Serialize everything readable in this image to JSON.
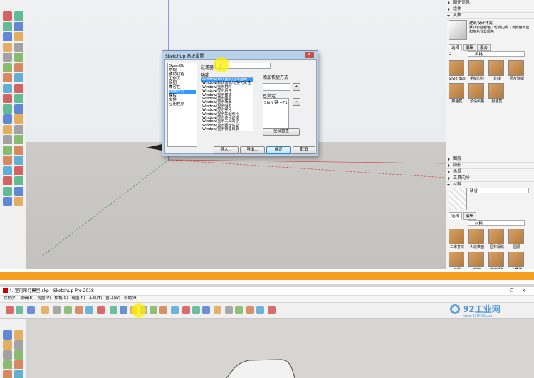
{
  "dialog": {
    "title": "SketchUp 系统设置",
    "close_glyph": "✕",
    "categories": [
      "OpenGL",
      "常规",
      "辅助功能",
      "工作区",
      "绘图",
      "兼容性",
      "快捷方式",
      "模板",
      "文件",
      "应用程序"
    ],
    "selected_category_index": 6,
    "filter_label": "过滤器",
    "filter_value": "",
    "function_label": "功能",
    "functions": [
      "Window/默认面板/显示面板",
      "Window/默认面板/切换可见性",
      "Window/显示材料",
      "Window/显示组件",
      "Window/显示样式",
      "Window/显示图层",
      "Window/显示场景",
      "Window/显示阴影",
      "Window/显示雾化",
      "Window/显示匹配照片",
      "Window/显示柔化边线",
      "Window/显示工具向导",
      "Window/显示图元信息",
      "Window/显示管理目录",
      "Window/显示大纲"
    ],
    "add_shortcut_label": "添加快捷方式",
    "assigned_label": "已指定",
    "assigned_value": "Shift 键 +F1",
    "plus_glyph": "+",
    "minus_glyph": "-",
    "reset_all": "全部重置",
    "import_btn": "导入...",
    "export_btn": "导出...",
    "ok_btn": "确定",
    "cancel_btn": "取消"
  },
  "tray": {
    "rows_top": [
      "图元信息",
      "组件",
      "风格"
    ],
    "style_name": "建筑设计样式",
    "style_desc": "默认表面颜色 · 轮廓边线 · 淡颜色天空和灰色背景颜色",
    "tabs": [
      "选择",
      "编辑",
      "混合"
    ],
    "style_dropdown": "风格",
    "style_items": [
      "Style Builder 竞赛获胜者",
      "手绘边线",
      "直线",
      "照片建模",
      "颜色集",
      "预设风格",
      "颜色集"
    ],
    "rows_mid": [
      "图层",
      "阴影",
      "场景",
      "工具向导",
      "材料"
    ],
    "material_name": "缺省",
    "mat_tabs": [
      "选择",
      "编辑"
    ],
    "material_dropdown": "材料",
    "material_items": [
      "三维打印",
      "人造表面",
      "园林绿化",
      "图层",
      "地毯",
      "窗帘",
      "指定颜色",
      "木质纹"
    ]
  },
  "bottom": {
    "title": "4. 室内吊灯模型.skp - SketchUp Pro 2018",
    "menu": [
      "文件(F)",
      "编辑(E)",
      "视图(V)",
      "相机(C)",
      "绘图(R)",
      "工具(T)",
      "窗口(W)",
      "帮助(H)"
    ],
    "logo_text": "92工业网",
    "logo_url": "www.92GYW.com"
  },
  "colors": {
    "accent": "#f49f1e",
    "selection": "#3399ff",
    "highlight": "#fff000",
    "dialog_frame": "#b9d1ea"
  }
}
